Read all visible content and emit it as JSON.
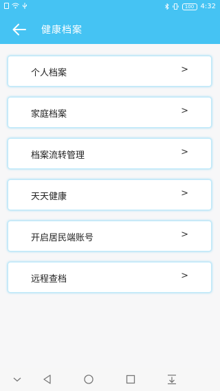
{
  "status_bar": {
    "time": "4:32",
    "battery": "100"
  },
  "header": {
    "title": "健康档案"
  },
  "menu": {
    "items": [
      {
        "label": "个人档案",
        "chevron": ">"
      },
      {
        "label": "家庭档案",
        "chevron": ">"
      },
      {
        "label": "档案流转管理",
        "chevron": ">"
      },
      {
        "label": "天天健康",
        "chevron": ">"
      },
      {
        "label": "开启居民端账号",
        "chevron": ">"
      },
      {
        "label": "远程查档",
        "chevron": ">"
      }
    ]
  },
  "colors": {
    "header_bg": "#45c3f3",
    "card_border": "#bfe9fa"
  },
  "icons": {
    "back": "arrow-left-icon",
    "system_nav": [
      "chevron-down-icon",
      "triangle-back-icon",
      "circle-home-icon",
      "square-recents-icon",
      "download-icon"
    ]
  }
}
